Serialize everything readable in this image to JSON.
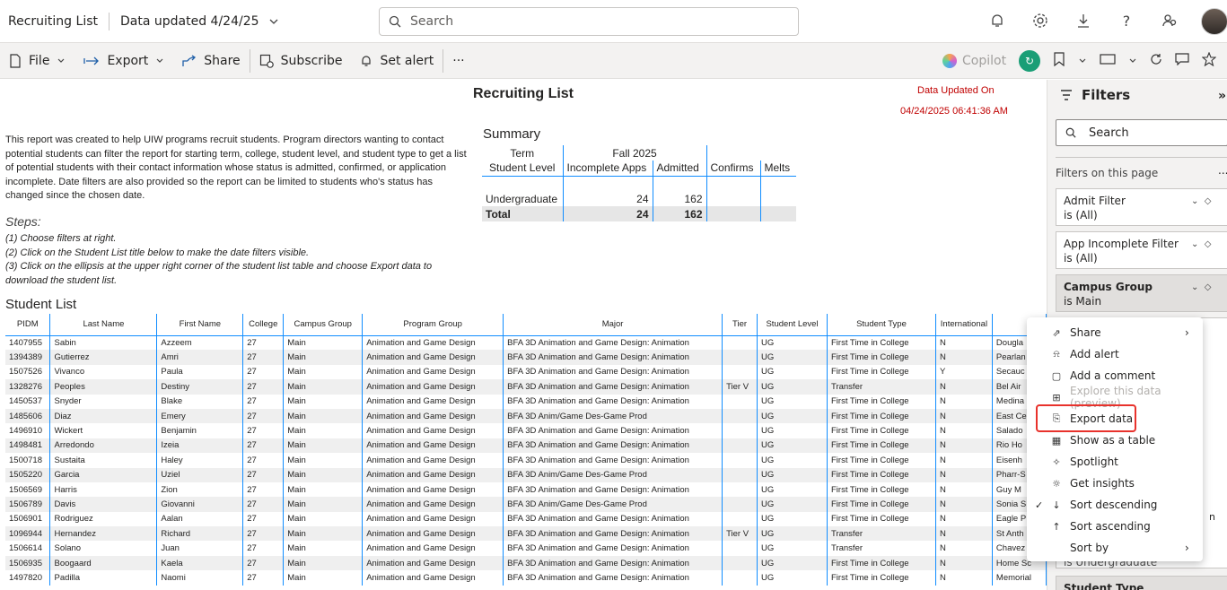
{
  "topbar": {
    "title": "Recruiting List",
    "data_updated": "Data updated 4/24/25",
    "search_placeholder": "Search"
  },
  "toolbar": {
    "file": "File",
    "export": "Export",
    "share": "Share",
    "subscribe": "Subscribe",
    "set_alert": "Set alert",
    "more": "···",
    "copilot": "Copilot"
  },
  "report": {
    "title": "Recruiting List",
    "updated_label": "Data Updated On",
    "updated_value": "04/24/2025 06:41:36 AM",
    "intro": "This report was created to help UIW programs recruit students. Program directors wanting to contact potential students can filter the report for starting term, college, student level, and student type to get a list of potential students with their contact information whose status is admitted, confirmed, or application incomplete.  Date filters are also provided so the report can be limited to students who's status has changed since the chosen date.",
    "steps_heading": "Steps:",
    "steps": [
      "(1) Choose filters at right.",
      "(2) Click on the Student List title below to make the date filters visible.",
      "(3) Click on the ellipsis at the upper right corner of the student list table and choose Export data to",
      "download the student list."
    ],
    "summary": {
      "heading": "Summary",
      "term_label": "Term",
      "term_value": "Fall 2025",
      "level_label": "Student Level",
      "cols": [
        "Incomplete Apps",
        "Admitted",
        "Confirms",
        "Melts"
      ],
      "rows": [
        {
          "label": "Undergraduate",
          "values": [
            "24",
            "162",
            "",
            ""
          ]
        },
        {
          "label": "Total",
          "values": [
            "24",
            "162",
            "",
            ""
          ]
        }
      ]
    },
    "student_list_title": "Student List",
    "student_columns": [
      "PIDM",
      "Last Name",
      "First Name",
      "College",
      "Campus Group",
      "Program Group",
      "Major",
      "Tier",
      "Student Level",
      "Student Type",
      "International",
      ""
    ],
    "students": [
      [
        "1407955",
        "Sabin",
        "Azzeem",
        "27",
        "Main",
        "Animation and Game Design",
        "BFA 3D Animation and Game Design: Animation",
        "",
        "UG",
        "First Time in College",
        "N",
        "Dougla"
      ],
      [
        "1394389",
        "Gutierrez",
        "Amri",
        "27",
        "Main",
        "Animation and Game Design",
        "BFA 3D Animation and Game Design: Animation",
        "",
        "UG",
        "First Time in College",
        "N",
        "Pearlan"
      ],
      [
        "1507526",
        "Vivanco",
        "Paula",
        "27",
        "Main",
        "Animation and Game Design",
        "BFA 3D Animation and Game Design: Animation",
        "",
        "UG",
        "First Time in College",
        "Y",
        "Secauc"
      ],
      [
        "1328276",
        "Peoples",
        "Destiny",
        "27",
        "Main",
        "Animation and Game Design",
        "BFA 3D Animation and Game Design: Animation",
        "Tier V",
        "UG",
        "Transfer",
        "N",
        "Bel Air"
      ],
      [
        "1450537",
        "Snyder",
        "Blake",
        "27",
        "Main",
        "Animation and Game Design",
        "BFA 3D Animation and Game Design: Animation",
        "",
        "UG",
        "First Time in College",
        "N",
        "Medina"
      ],
      [
        "1485606",
        "Diaz",
        "Emery",
        "27",
        "Main",
        "Animation and Game Design",
        "BFA 3D Anim/Game Des-Game Prod",
        "",
        "UG",
        "First Time in College",
        "N",
        "East Ce"
      ],
      [
        "1496910",
        "Wickert",
        "Benjamin",
        "27",
        "Main",
        "Animation and Game Design",
        "BFA 3D Animation and Game Design: Animation",
        "",
        "UG",
        "First Time in College",
        "N",
        "Salado"
      ],
      [
        "1498481",
        "Arredondo",
        "Izeia",
        "27",
        "Main",
        "Animation and Game Design",
        "BFA 3D Animation and Game Design: Animation",
        "",
        "UG",
        "First Time in College",
        "N",
        "Rio Ho"
      ],
      [
        "1500718",
        "Sustaita",
        "Haley",
        "27",
        "Main",
        "Animation and Game Design",
        "BFA 3D Animation and Game Design: Animation",
        "",
        "UG",
        "First Time in College",
        "N",
        "Eisenh"
      ],
      [
        "1505220",
        "Garcia",
        "Uziel",
        "27",
        "Main",
        "Animation and Game Design",
        "BFA 3D Anim/Game Des-Game Prod",
        "",
        "UG",
        "First Time in College",
        "N",
        "Pharr-S"
      ],
      [
        "1506569",
        "Harris",
        "Zion",
        "27",
        "Main",
        "Animation and Game Design",
        "BFA 3D Animation and Game Design: Animation",
        "",
        "UG",
        "First Time in College",
        "N",
        "Guy M"
      ],
      [
        "1506789",
        "Davis",
        "Giovanni",
        "27",
        "Main",
        "Animation and Game Design",
        "BFA 3D Anim/Game Des-Game Prod",
        "",
        "UG",
        "First Time in College",
        "N",
        "Sonia S"
      ],
      [
        "1506901",
        "Rodriguez",
        "Aalan",
        "27",
        "Main",
        "Animation and Game Design",
        "BFA 3D Animation and Game Design: Animation",
        "",
        "UG",
        "First Time in College",
        "N",
        "Eagle P"
      ],
      [
        "1096944",
        "Hernandez",
        "Richard",
        "27",
        "Main",
        "Animation and Game Design",
        "BFA 3D Animation and Game Design: Animation",
        "Tier V",
        "UG",
        "Transfer",
        "N",
        "St Anth"
      ],
      [
        "1506614",
        "Solano",
        "Juan",
        "27",
        "Main",
        "Animation and Game Design",
        "BFA 3D Animation and Game Design: Animation",
        "",
        "UG",
        "Transfer",
        "N",
        "Chavez"
      ],
      [
        "1506935",
        "Boogaard",
        "Kaela",
        "27",
        "Main",
        "Animation and Game Design",
        "BFA 3D Animation and Game Design: Animation",
        "",
        "UG",
        "First Time in College",
        "N",
        "Home Sc"
      ],
      [
        "1497820",
        "Padilla",
        "Naomi",
        "27",
        "Main",
        "Animation and Game Design",
        "BFA 3D Animation and Game Design: Animation",
        "",
        "UG",
        "First Time in College",
        "N",
        "Memorial"
      ]
    ]
  },
  "filters": {
    "title": "Filters",
    "search_placeholder": "Search",
    "on_page": "Filters on this page",
    "more": "...",
    "cards": [
      {
        "name": "Admit Filter",
        "value": "is (All)",
        "bold": false
      },
      {
        "name": "App Incomplete Filter",
        "value": "is (All)",
        "bold": false
      },
      {
        "name": "Campus Group",
        "value": "is Main",
        "bold": true
      }
    ],
    "hidden_peek_1": "n",
    "hidden_peek_2": "is Undergraduate",
    "hidden_peek_3": "Student Type"
  },
  "context_menu": {
    "items": [
      {
        "label": "Share",
        "icon": "share-icon",
        "submenu": true,
        "disabled": false,
        "checked": false
      },
      {
        "label": "Add alert",
        "icon": "bell-icon",
        "submenu": false,
        "disabled": false,
        "checked": false
      },
      {
        "label": "Add a comment",
        "icon": "comment-icon",
        "submenu": false,
        "disabled": false,
        "checked": false
      },
      {
        "label": "Explore this data (preview)",
        "icon": "explore-icon",
        "submenu": false,
        "disabled": true,
        "checked": false
      },
      {
        "label": "Export data",
        "icon": "export-icon",
        "submenu": false,
        "disabled": false,
        "checked": false
      },
      {
        "label": "Show as a table",
        "icon": "table-icon",
        "submenu": false,
        "disabled": false,
        "checked": false
      },
      {
        "label": "Spotlight",
        "icon": "spotlight-icon",
        "submenu": false,
        "disabled": false,
        "checked": false
      },
      {
        "label": "Get insights",
        "icon": "lightbulb-icon",
        "submenu": false,
        "disabled": false,
        "checked": false
      },
      {
        "label": "Sort descending",
        "icon": "sort-desc-icon",
        "submenu": false,
        "disabled": false,
        "checked": true
      },
      {
        "label": "Sort ascending",
        "icon": "sort-asc-icon",
        "submenu": false,
        "disabled": false,
        "checked": false
      },
      {
        "label": "Sort by",
        "icon": "",
        "submenu": true,
        "disabled": false,
        "checked": false
      }
    ]
  },
  "colors": {
    "accent_blue": "#118dff",
    "updated_red": "#c00000",
    "highlight_red": "#e8322c",
    "copilot_green": "#1a9e76"
  }
}
